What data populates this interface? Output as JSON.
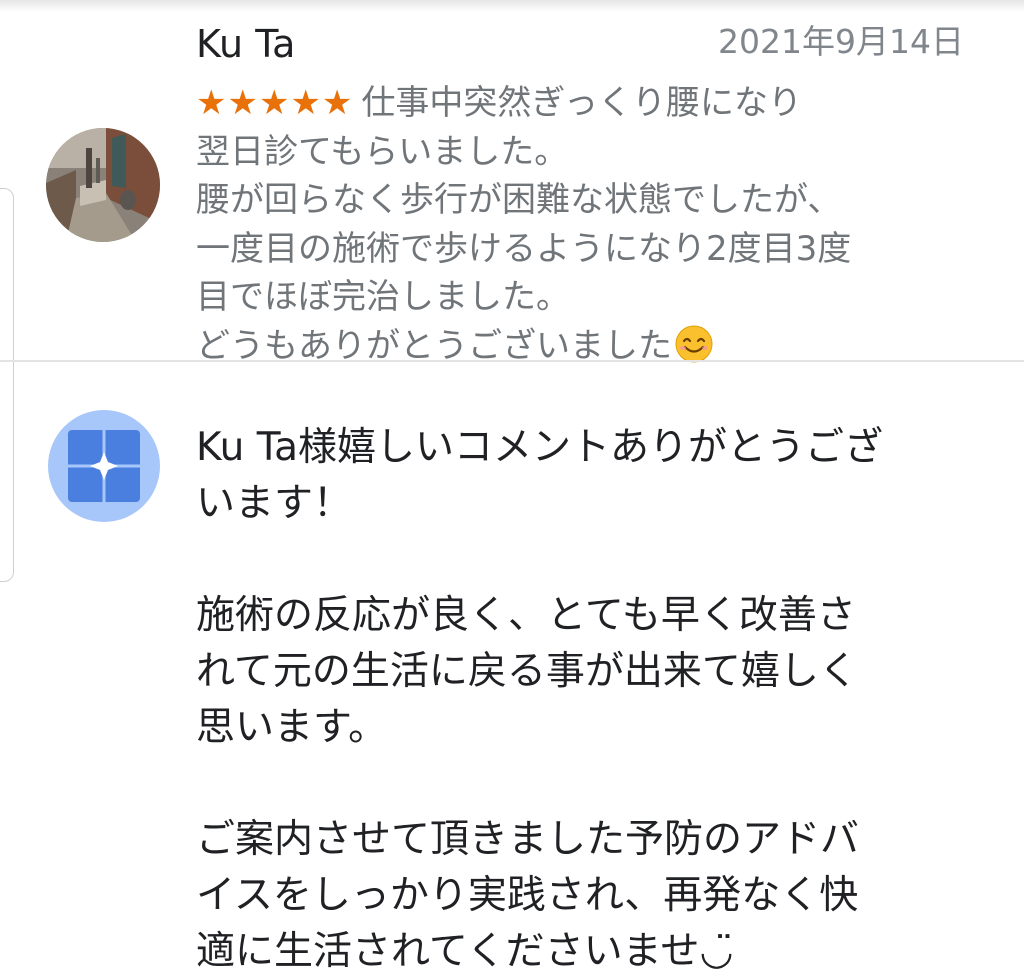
{
  "review": {
    "reviewer_name": "Ku Ta",
    "date": "2021年9月14日",
    "rating": 5,
    "stars": "★★★★★",
    "text_lines": [
      "仕事中突然ぎっくり腰になり",
      "翌日診てもらいました。",
      "腰が回らなく歩行が困難な状態でしたが、",
      "一度目の施術で歩けるようになり2度目3度",
      "目でほぼ完治しました。",
      "どうもありがとうございました"
    ],
    "emoji": "smiling-face-emoji"
  },
  "owner_reply": {
    "avatar_icon": "business-logo-icon",
    "para1": [
      "Ku Ta様嬉しいコメントありがとうござ",
      "います！"
    ],
    "para2": [
      "施術の反応が良く、とても早く改善さ",
      "れて元の生活に戻る事が出来て嬉しく",
      "思います。"
    ],
    "para3": [
      "ご案内させて頂きました予防のアドバ",
      "イスをしっかり実践され、再発なく快",
      "適に生活されてくださいませ◡̈"
    ]
  },
  "colors": {
    "star": "#e8710a",
    "secondary_text": "#70757a",
    "date_text": "#80868b",
    "owner_avatar_bg": "#a7c7fa",
    "owner_logo": "#4a7fe0"
  }
}
